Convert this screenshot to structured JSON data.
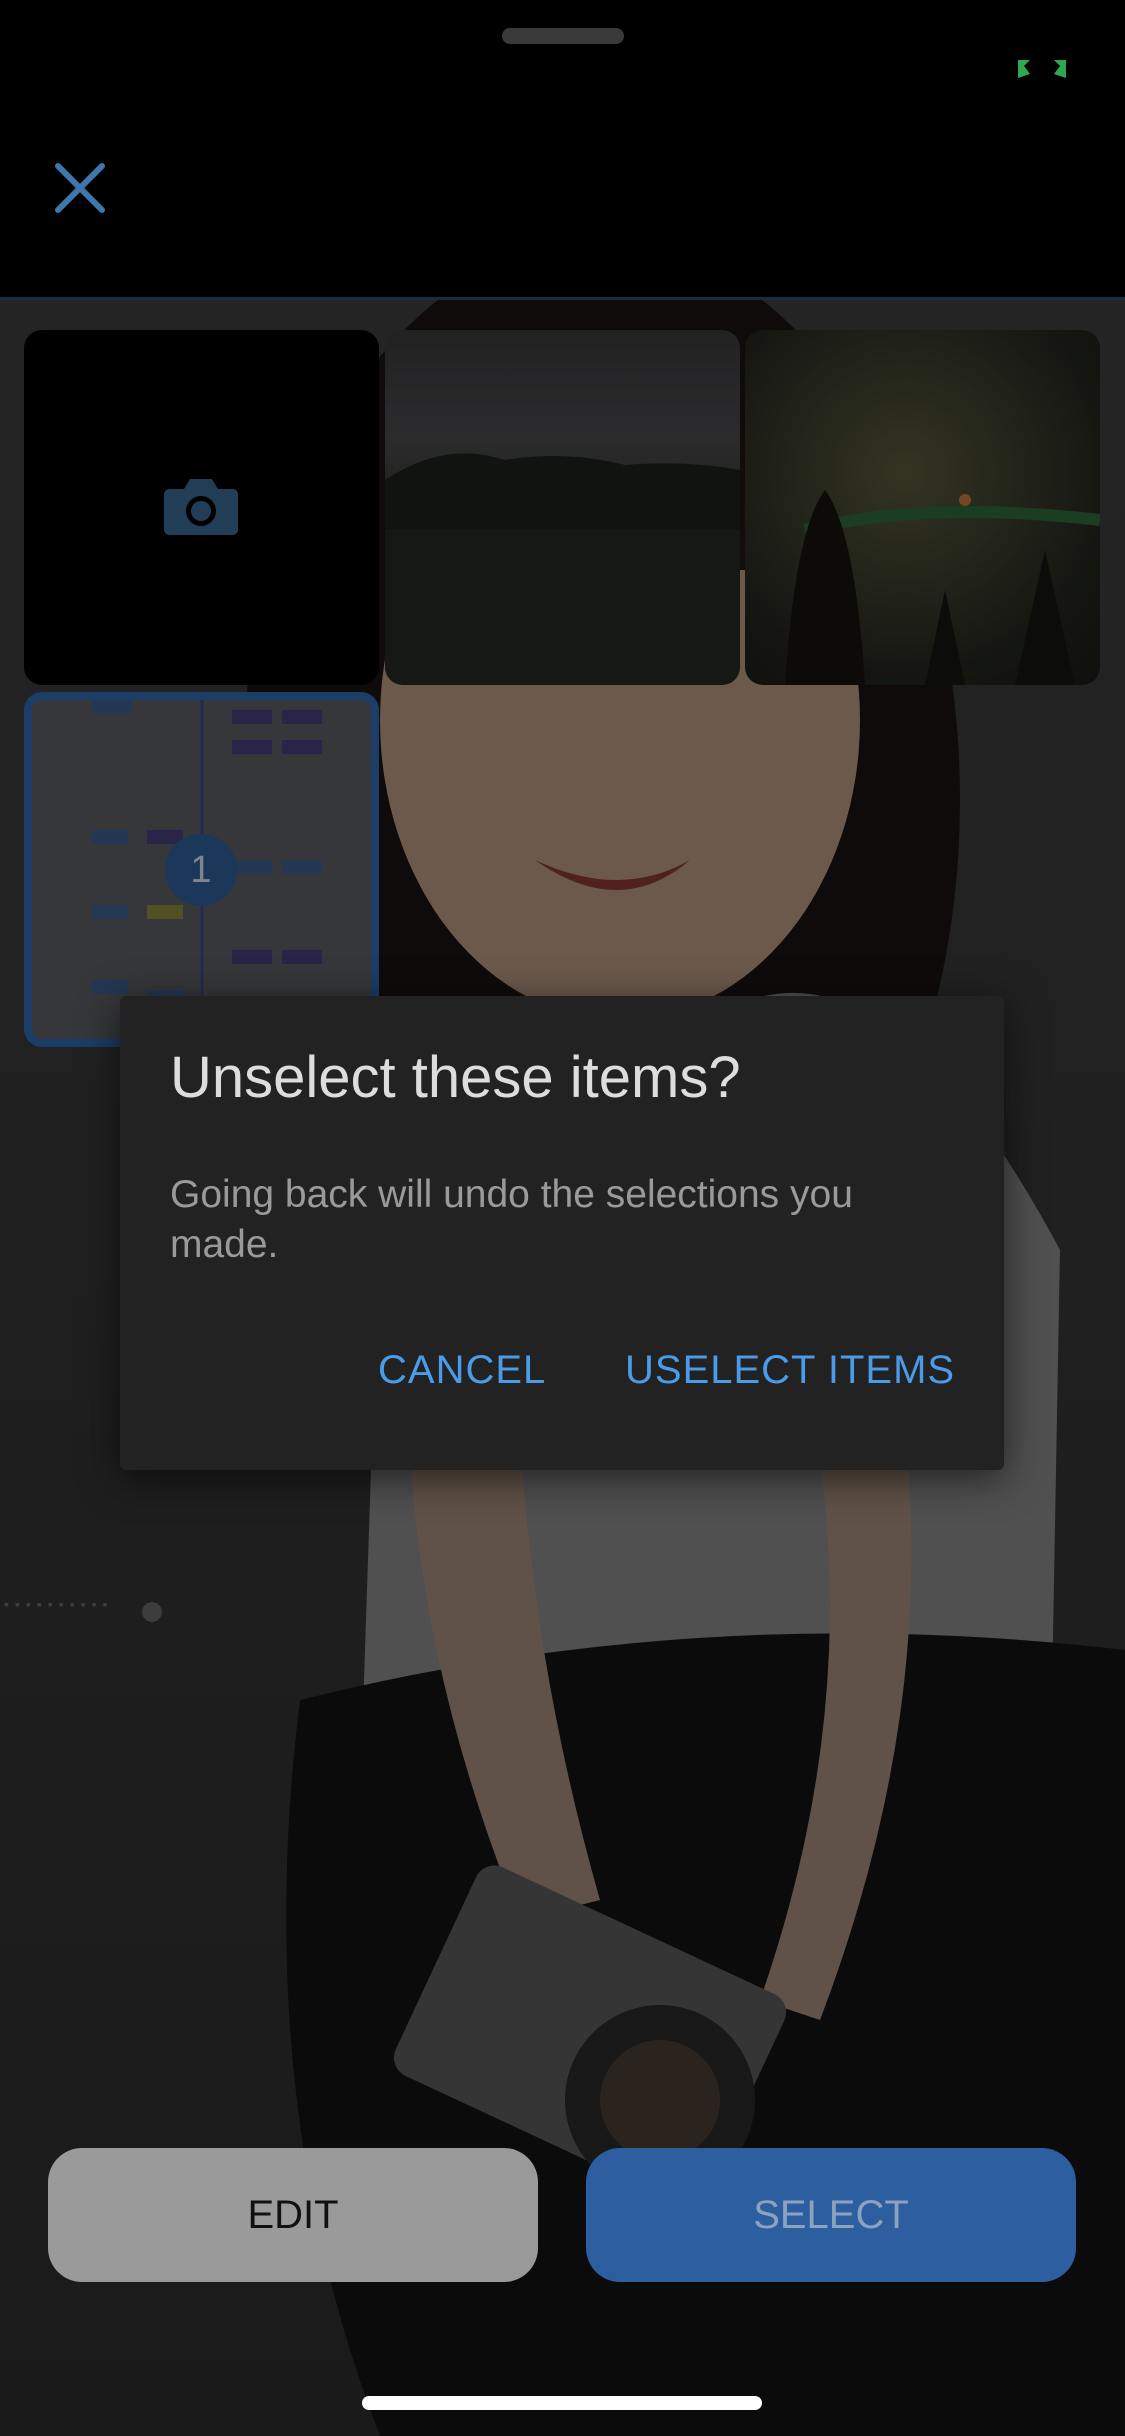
{
  "header": {
    "close_icon": "close-icon",
    "status_indicator_icon": "fullscreen-indicator-icon"
  },
  "grid": {
    "camera_tile_icon": "camera-icon",
    "selected_badge": "1"
  },
  "dialog": {
    "title": "Unselect these items?",
    "body": "Going back will undo the selections you made.",
    "cancel_label": "CANCEL",
    "confirm_label": "USELECT ITEMS"
  },
  "bottom_bar": {
    "edit_label": "EDIT",
    "select_label": "SELECT"
  },
  "colors": {
    "accent": "#4a9be8",
    "select_button": "#2c5ea0",
    "dialog_bg": "#222222"
  }
}
